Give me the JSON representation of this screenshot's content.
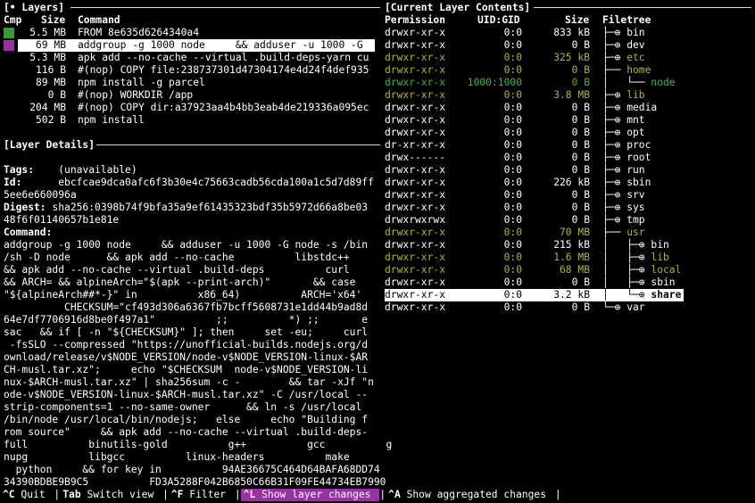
{
  "layers_panel": {
    "title": "[• Layers]",
    "headers": {
      "cmp": "Cmp",
      "size": "Size",
      "command": "Command"
    },
    "rows": [
      {
        "size": "5.5 MB",
        "command": "FROM 8e635d6264340a4",
        "swatch": "#3a9a3a"
      },
      {
        "size": "69 MB",
        "command": "addgroup -g 1000 node     && adduser -u 1000 -G",
        "swatch": "#9b30a6",
        "selected": true
      },
      {
        "size": "5.3 MB",
        "command": "apk add --no-cache --virtual .build-deps-yarn cu"
      },
      {
        "size": "116 B",
        "command": "#(nop) COPY file:238737301d47304174e4d24f4def935"
      },
      {
        "size": "89 MB",
        "command": "npm install -g parcel"
      },
      {
        "size": "0 B",
        "command": "#(nop) WORKDIR /app"
      },
      {
        "size": "204 MB",
        "command": "#(nop) COPY dir:a37923aa4b4bb3eab4de219336a095ec"
      },
      {
        "size": "502 B",
        "command": "npm install"
      }
    ]
  },
  "details_panel": {
    "title": "[Layer Details]",
    "tags_label": "Tags:",
    "tags_value": "(unavailable)",
    "id_label": "Id:",
    "id_line1": "ebcfcae9dca0afc6f3b30e4c75663cadb56cda100a1c5d7d89ff",
    "id_line2": "5ee6e660096a",
    "digest_label": "Digest:",
    "digest_line1": "sha256:0398b74f9bfa35a9ef61435323bdf35b5972d66a8be03",
    "digest_line2": "48f6f01140657b1e81e",
    "command_label": "Command:",
    "command_lines": [
      "addgroup -g 1000 node     && adduser -u 1000 -G node -s /bin",
      "/sh -D node      && apk add --no-cache          libstdc++",
      "&& apk add --no-cache --virtual .build-deps          curl",
      "&& ARCH= && alpineArch=\"$(apk --print-arch)\"       && case",
      "\"${alpineArch##*-}\" in          x86_64)          ARCH='x64'",
      "          CHECKSUM=\"cf493d306a6367fb7bcff5608731e1dd44b9ad8d",
      "64e7df7706916d8be0f497a1\"          ;;          *) ;;       e",
      "sac   && if [ -n \"${CHECKSUM}\" ]; then     set -eu;     curl",
      " -fsSLO --compressed \"https://unofficial-builds.nodejs.org/d",
      "ownload/release/v$NODE_VERSION/node-v$NODE_VERSION-linux-$AR",
      "CH-musl.tar.xz\";     echo \"$CHECKSUM  node-v$NODE_VERSION-li",
      "nux-$ARCH-musl.tar.xz\" | sha256sum -c -        && tar -xJf \"n",
      "ode-v$NODE_VERSION-linux-$ARCH-musl.tar.xz\" -C /usr/local --",
      "strip-components=1 --no-same-owner      && ln -s /usr/local",
      "/bin/node /usr/local/bin/nodejs;   else     echo \"Building f",
      "rom source\"     && apk add --no-cache --virtual .build-deps-",
      "full          binutils-gold          g++          gcc          g",
      "nupg          libgcc          linux-headers          make",
      "  python     && for key in          94AE36675C464D64BAFA68DD74",
      "34390BDBE9B9C5          FD3A5288F042B6850C66B31F09FE44734EB7990"
    ]
  },
  "contents_panel": {
    "title": "[Current Layer Contents]",
    "headers": {
      "permission": "Permission",
      "uidgid": "UID:GID",
      "size": "Size",
      "filetree": "Filetree"
    },
    "rows": [
      {
        "perm": "drwxr-xr-x",
        "uid": "0:0",
        "size": "833 kB",
        "tree": "├─⊕ ",
        "name": "bin",
        "state": "unchanged"
      },
      {
        "perm": "drwxr-xr-x",
        "uid": "0:0",
        "size": "0 B",
        "tree": "├─⊕ ",
        "name": "dev",
        "state": "unchanged"
      },
      {
        "perm": "drwxr-xr-x",
        "uid": "0:0",
        "size": "325 kB",
        "tree": "├─⊕ ",
        "name": "etc",
        "state": "modified"
      },
      {
        "perm": "drwxr-xr-x",
        "uid": "0:0",
        "size": "0 B",
        "tree": "├── ",
        "name": "home",
        "state": "modified"
      },
      {
        "perm": "drwxr-xr-x",
        "uid": "1000:1000",
        "size": "0 B",
        "tree": "│   └── ",
        "name": "node",
        "state": "added"
      },
      {
        "perm": "drwxr-xr-x",
        "uid": "0:0",
        "size": "3.8 MB",
        "tree": "├─⊕ ",
        "name": "lib",
        "state": "modified"
      },
      {
        "perm": "drwxr-xr-x",
        "uid": "0:0",
        "size": "0 B",
        "tree": "├─⊕ ",
        "name": "media",
        "state": "unchanged"
      },
      {
        "perm": "drwxr-xr-x",
        "uid": "0:0",
        "size": "0 B",
        "tree": "├─⊕ ",
        "name": "mnt",
        "state": "unchanged"
      },
      {
        "perm": "drwxr-xr-x",
        "uid": "0:0",
        "size": "0 B",
        "tree": "├─⊕ ",
        "name": "opt",
        "state": "unchanged"
      },
      {
        "perm": "dr-xr-xr-x",
        "uid": "0:0",
        "size": "0 B",
        "tree": "├─⊕ ",
        "name": "proc",
        "state": "unchanged"
      },
      {
        "perm": "drwx------",
        "uid": "0:0",
        "size": "0 B",
        "tree": "├─⊕ ",
        "name": "root",
        "state": "unchanged"
      },
      {
        "perm": "drwxr-xr-x",
        "uid": "0:0",
        "size": "0 B",
        "tree": "├─⊕ ",
        "name": "run",
        "state": "unchanged"
      },
      {
        "perm": "drwxr-xr-x",
        "uid": "0:0",
        "size": "226 kB",
        "tree": "├─⊕ ",
        "name": "sbin",
        "state": "unchanged"
      },
      {
        "perm": "drwxr-xr-x",
        "uid": "0:0",
        "size": "0 B",
        "tree": "├─⊕ ",
        "name": "srv",
        "state": "unchanged"
      },
      {
        "perm": "drwxr-xr-x",
        "uid": "0:0",
        "size": "0 B",
        "tree": "├─⊕ ",
        "name": "sys",
        "state": "unchanged"
      },
      {
        "perm": "drwxrwxrwx",
        "uid": "0:0",
        "size": "0 B",
        "tree": "├─⊕ ",
        "name": "tmp",
        "state": "unchanged"
      },
      {
        "perm": "drwxr-xr-x",
        "uid": "0:0",
        "size": "70 MB",
        "tree": "├── ",
        "name": "usr",
        "state": "modified"
      },
      {
        "perm": "drwxr-xr-x",
        "uid": "0:0",
        "size": "215 kB",
        "tree": "│   ├─⊕ ",
        "name": "bin",
        "state": "unchanged"
      },
      {
        "perm": "drwxr-xr-x",
        "uid": "0:0",
        "size": "1.6 MB",
        "tree": "│   ├─⊕ ",
        "name": "lib",
        "state": "modified"
      },
      {
        "perm": "drwxr-xr-x",
        "uid": "0:0",
        "size": "68 MB",
        "tree": "│   ├─⊕ ",
        "name": "local",
        "state": "modified"
      },
      {
        "perm": "drwxr-xr-x",
        "uid": "0:0",
        "size": "0 B",
        "tree": "│   ├─⊕ ",
        "name": "sbin",
        "state": "unchanged"
      },
      {
        "perm": "drwxr-xr-x",
        "uid": "0:0",
        "size": "3.2 kB",
        "tree": "│   └─⊕ ",
        "name": "share",
        "state": "unchanged",
        "selected": true
      },
      {
        "perm": "drwxr-xr-x",
        "uid": "0:0",
        "size": "0 B",
        "tree": "└─⊕ ",
        "name": "var",
        "state": "unchanged"
      }
    ]
  },
  "statusbar": {
    "items": [
      {
        "key": "^C",
        "label": "Quit",
        "highlight": false
      },
      {
        "key": "Tab",
        "label": "Switch view",
        "highlight": false
      },
      {
        "key": "^F",
        "label": "Filter",
        "highlight": false
      },
      {
        "key": "^L",
        "label": "Show layer changes",
        "highlight": true
      },
      {
        "key": "^A",
        "label": "Show aggregated changes",
        "highlight": false
      }
    ]
  },
  "colors": {
    "unchanged": "#ffffff",
    "modified": "#b5b52c",
    "added": "#3fb83f",
    "highlight": "#9b30a6"
  }
}
